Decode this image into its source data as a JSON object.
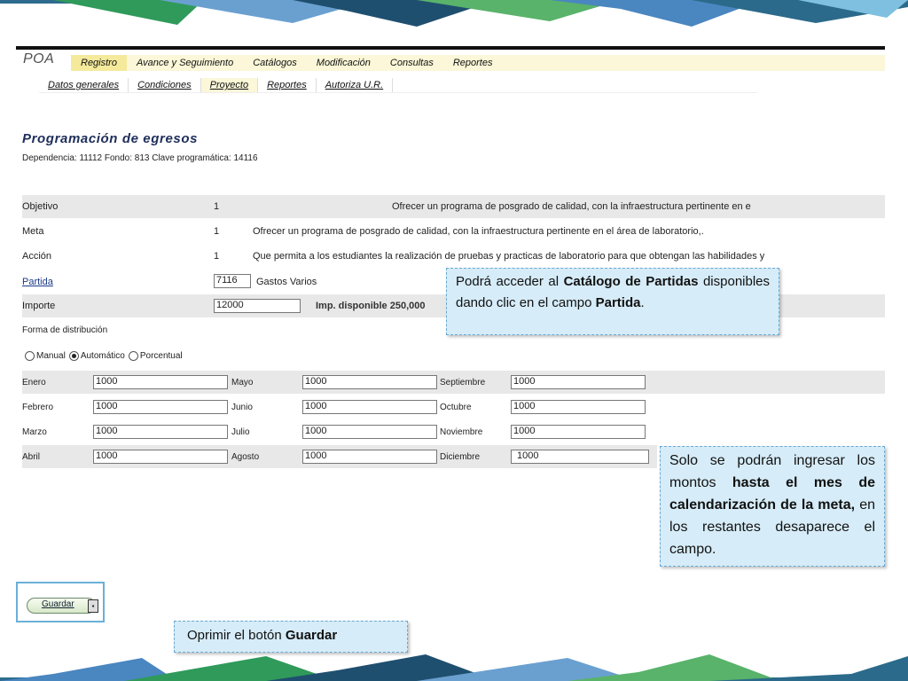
{
  "app": {
    "logo": "POA",
    "main_nav": [
      "Registro",
      "Avance y Seguimiento",
      "Catálogos",
      "Modificación",
      "Consultas",
      "Reportes"
    ],
    "sub_nav": [
      "Datos generales",
      "Condiciones",
      "Proyecto",
      "Reportes",
      "Autoriza U.R."
    ]
  },
  "page": {
    "title": "Programación de egresos",
    "dependencia_line": "Dependencia:  11112 Fondo: 813 Clave programática: 14116"
  },
  "fields": {
    "objetivo": {
      "label": "Objetivo",
      "num": "1",
      "text": "Ofrecer un programa de posgrado de calidad, con la infraestructura pertinente en e"
    },
    "meta": {
      "label": "Meta",
      "num": "1",
      "text": "Ofrecer un programa de posgrado de calidad, con la infraestructura pertinente en el área de laboratorio,."
    },
    "accion": {
      "label": "Acción",
      "num": "1",
      "text": "Que permita a los estudiantes la realización de pruebas y practicas de laboratorio para que obtengan las habilidades y"
    },
    "partida": {
      "label": "Partida",
      "value": "7116",
      "desc": "Gastos Varios"
    },
    "importe": {
      "label": "Importe",
      "value": "12000",
      "disponible": "Imp. disponible 250,000"
    },
    "forma_label": "Forma de distribución"
  },
  "distribution": {
    "options": [
      "Manual",
      "Automático",
      "Porcentual"
    ],
    "selected": "Automático"
  },
  "months": {
    "col1": [
      {
        "label": "Enero",
        "value": "1000"
      },
      {
        "label": "Febrero",
        "value": "1000"
      },
      {
        "label": "Marzo",
        "value": "1000"
      },
      {
        "label": "Abril",
        "value": "1000"
      }
    ],
    "col2": [
      {
        "label": "Mayo",
        "value": "1000"
      },
      {
        "label": "Junio",
        "value": "1000"
      },
      {
        "label": "Julio",
        "value": "1000"
      },
      {
        "label": "Agosto",
        "value": "1000"
      }
    ],
    "col3": [
      {
        "label": "Septiembre",
        "value": "1000"
      },
      {
        "label": "Octubre",
        "value": "1000"
      },
      {
        "label": "Noviembre",
        "value": "1000"
      },
      {
        "label": "Diciembre",
        "value": "1000"
      }
    ]
  },
  "buttons": {
    "save": "Guardar"
  },
  "callouts": {
    "partida_a": "Podrá acceder al ",
    "partida_b": "Catálogo de Partidas",
    "partida_c": " disponibles dando clic en el campo ",
    "partida_d": "Partida",
    "partida_e": ".",
    "meses_a": "Solo se podrán ingresar los montos ",
    "meses_b": "hasta el mes de calendarización de la meta,",
    "meses_c": " en los restantes desaparece el campo.",
    "guardar_a": "Oprimir el botón ",
    "guardar_b": "Guardar"
  },
  "colors": {
    "nav_bg": "#fbf7d8",
    "nav_active": "#f5ea9c",
    "row_shade": "#e8e8e8",
    "callout_bg": "#d6ecf8",
    "title": "#1e2e5a"
  }
}
